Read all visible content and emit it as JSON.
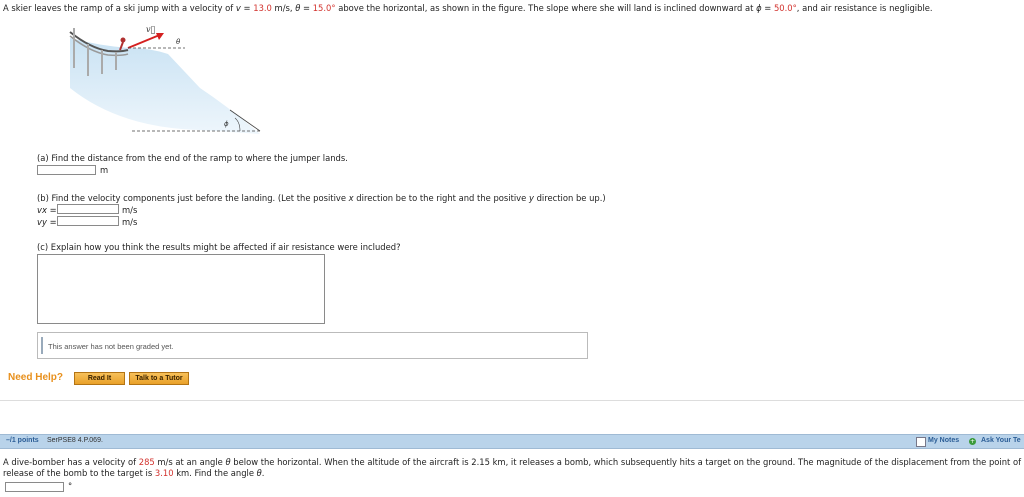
{
  "q1": {
    "intro": {
      "pre": "A skier leaves the ramp of a ski jump with a velocity of ",
      "v_var": "v",
      "eq1": " = ",
      "v_value": "13.0",
      "v_unit": " m/s, ",
      "theta": "θ",
      "eq2": " = ",
      "theta_value": "15.0°",
      "mid": " above the horizontal, as shown in the figure. The slope where she will land is inclined downward at ",
      "phi": "ϕ",
      "eq3": " = ",
      "phi_value": "50.0°",
      "post": ", and air resistance is negligible."
    },
    "figure": {
      "v_label": "v⃗",
      "theta_label": "θ",
      "phi_label": "ϕ"
    },
    "part_a": {
      "text": "(a) Find the distance from the end of the ramp to where the jumper lands.",
      "unit": "m",
      "value": ""
    },
    "part_b": {
      "text_pre": "(b) Find the velocity components just before the landing. (Let the positive ",
      "x": "x",
      "text_mid": " direction be to the right and the positive ",
      "y": "y",
      "text_post": " direction be up.)",
      "vx_label": "vx =",
      "vy_label": "vy =",
      "vx_unit": "m/s",
      "vy_unit": "m/s",
      "vx_value": "",
      "vy_value": ""
    },
    "part_c": {
      "text": "(c) Explain how you think the results might be affected if air resistance were included?",
      "value": ""
    },
    "graded_text": "This answer has not been graded yet.",
    "need_help": "Need Help?",
    "read_it": "Read It",
    "talk_tutor": "Talk to a Tutor"
  },
  "q2": {
    "points": "–/1 points",
    "code": "SerPSE8 4.P.069.",
    "my_notes": "My Notes",
    "ask_teacher": "Ask Your Te",
    "text1_a": "A dive-bomber has a velocity of ",
    "velocity": "285",
    "text1_b": " m/s at an angle ",
    "theta": "θ",
    "text1_c": " below the horizontal. When the altitude of the aircraft is 2.15 km, it releases a bomb, which subsequently hits a target on the ground. The magnitude of the displacement from the point of",
    "text2_a": "release of the bomb to the target is ",
    "distance": "3.10",
    "text2_b": " km. Find the angle ",
    "text2_theta": "θ",
    "text2_c": ".",
    "deg_unit": "°",
    "answer": ""
  },
  "colors": {
    "header_bar": "#b9d3ea",
    "need_help": "#e8901c",
    "red_value": "#d2322d"
  }
}
